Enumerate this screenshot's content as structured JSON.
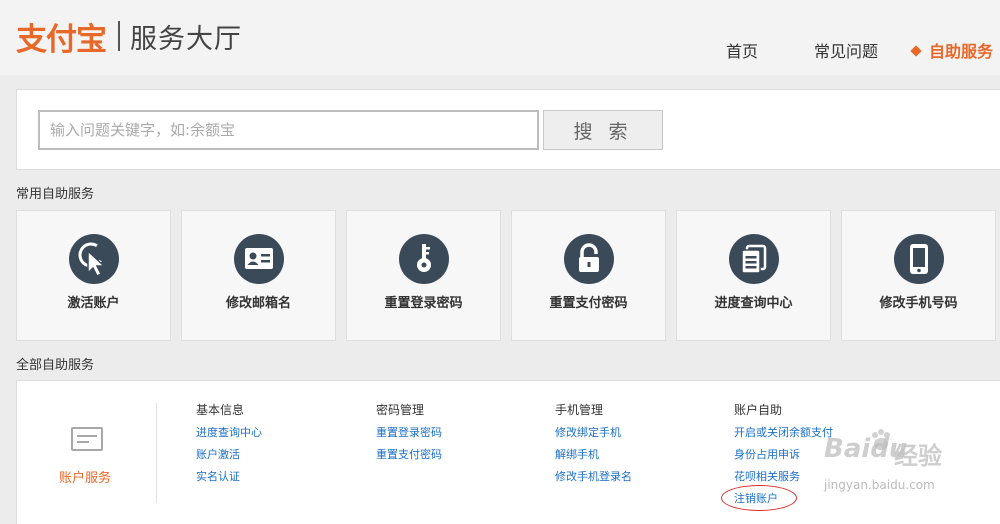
{
  "header": {
    "logo_text": "支付宝",
    "site_title": "服务大厅",
    "nav": {
      "home": "首页",
      "faq": "常见问题",
      "self_service": "自助服务"
    }
  },
  "search": {
    "placeholder": "输入问题关键字，如:余额宝",
    "value": "",
    "button": "搜 索"
  },
  "common": {
    "title": "常用自助服务",
    "cards": [
      {
        "label": "激活账户",
        "icon": "cursor-click-icon"
      },
      {
        "label": "修改邮箱名",
        "icon": "id-card-icon"
      },
      {
        "label": "重置登录密码",
        "icon": "key-icon"
      },
      {
        "label": "重置支付密码",
        "icon": "lock-icon"
      },
      {
        "label": "进度查询中心",
        "icon": "document-stack-icon"
      },
      {
        "label": "修改手机号码",
        "icon": "mobile-phone-icon"
      }
    ]
  },
  "all": {
    "title": "全部自助服务",
    "category": {
      "label": "账户服务",
      "icon": "account-card-icon"
    },
    "columns": [
      {
        "heading": "基本信息",
        "links": [
          "进度查询中心",
          "账户激活",
          "实名认证"
        ]
      },
      {
        "heading": "密码管理",
        "links": [
          "重置登录密码",
          "重置支付密码"
        ]
      },
      {
        "heading": "手机管理",
        "links": [
          "修改绑定手机",
          "解绑手机",
          "修改手机登录名"
        ]
      },
      {
        "heading": "账户自助",
        "links": [
          "开启或关闭余额支付",
          "身份占用申诉",
          "花呗相关服务",
          "注销账户"
        ]
      }
    ]
  },
  "watermark": {
    "brand": "Baidu",
    "brand_cn": "经验",
    "url": "jingyan.baidu.com"
  },
  "colors": {
    "accent": "#e8682a",
    "link": "#1b6fc7",
    "icon_circle": "#3b4a59",
    "highlight": "#d9302c"
  }
}
